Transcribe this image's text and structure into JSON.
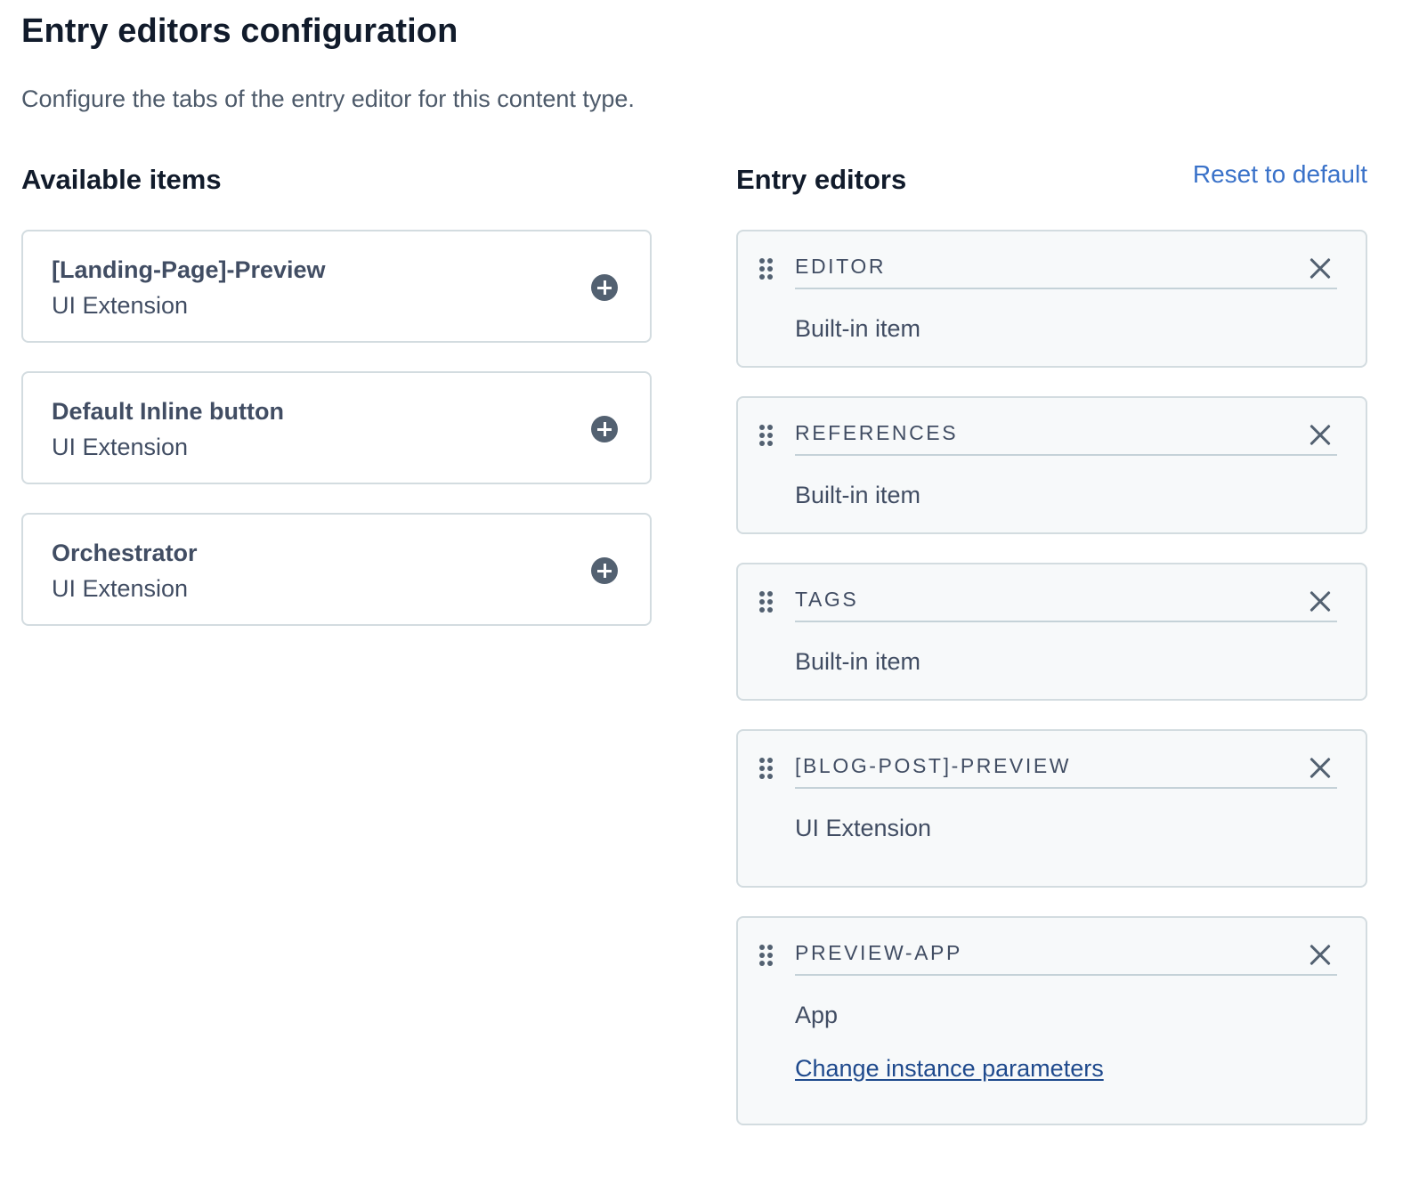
{
  "page": {
    "title": "Entry editors configuration",
    "description": "Configure the tabs of the entry editor for this content type."
  },
  "available": {
    "heading": "Available items",
    "items": [
      {
        "name": "[Landing-Page]-Preview",
        "type": "UI Extension",
        "action_icon": "plus-circle-icon"
      },
      {
        "name": "Default Inline button",
        "type": "UI Extension",
        "action_icon": "plus-circle-icon"
      },
      {
        "name": "Orchestrator",
        "type": "UI Extension",
        "action_icon": "plus-circle-icon"
      }
    ]
  },
  "editors": {
    "heading": "Entry editors",
    "reset_label": "Reset to default",
    "items": [
      {
        "name": "EDITOR",
        "type": "Built-in item"
      },
      {
        "name": "REFERENCES",
        "type": "Built-in item"
      },
      {
        "name": "TAGS",
        "type": "Built-in item"
      },
      {
        "name": "[BLOG-POST]-PREVIEW",
        "type": "UI Extension"
      },
      {
        "name": "PREVIEW-APP",
        "type": "App",
        "link_label": "Change instance parameters"
      }
    ]
  },
  "colors": {
    "link": "#3a72c9",
    "link_dark": "#1f4a8d",
    "card_border": "#d3dce0",
    "editor_card_bg": "#f7f9fa",
    "icon": "#536171"
  }
}
